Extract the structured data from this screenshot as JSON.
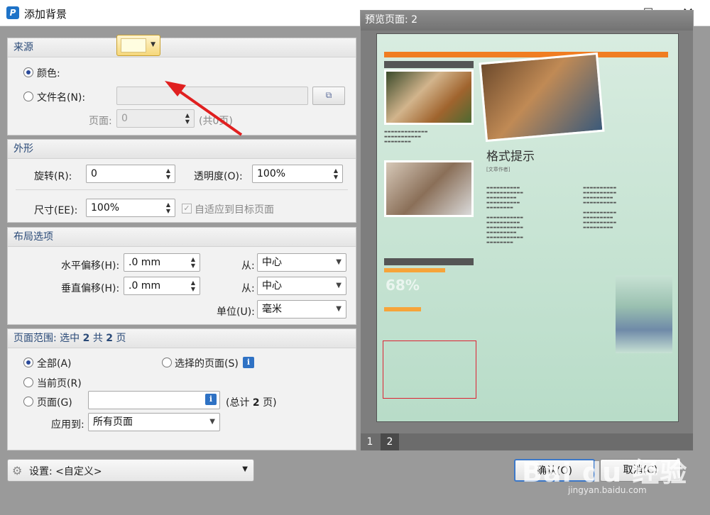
{
  "window": {
    "title": "添加背景"
  },
  "source": {
    "header": "来源",
    "color_label": "颜色:",
    "file_label": "文件名(N):",
    "page_label": "页面:",
    "page_value": "0",
    "page_total": "(共0页)",
    "color_value": "#fffde0"
  },
  "appearance": {
    "header": "外形",
    "rotate_label": "旋转(R):",
    "rotate_value": "0",
    "opacity_label": "透明度(O):",
    "opacity_value": "100%",
    "size_label": "尺寸(EE):",
    "size_value": "100%",
    "fit_label": "自适应到目标页面"
  },
  "layout": {
    "header": "布局选项",
    "h_offset_label": "水平偏移(H):",
    "h_offset_value": ".0 mm",
    "v_offset_label": "垂直偏移(H):",
    "v_offset_value": ".0 mm",
    "from_label": "从:",
    "h_from_value": "中心",
    "v_from_value": "中心",
    "unit_label": "单位(U):",
    "unit_value": "毫米"
  },
  "range": {
    "header_prefix": "页面范围: 选中",
    "header_selected": "2",
    "header_mid": "共",
    "header_total": "2",
    "header_suffix": "页",
    "all_label": "全部(A)",
    "selected_label": "选择的页面(S)",
    "current_label": "当前页(R)",
    "pages_label": "页面(G)",
    "pages_total_prefix": "(总计",
    "pages_total_num": "2",
    "pages_total_suffix": "页)",
    "apply_label": "应用到:",
    "apply_value": "所有页面"
  },
  "preview": {
    "header": "预览页面: 2",
    "pages": [
      "1",
      "2"
    ],
    "page_title": "格式提示",
    "page_author": "[文章作者]",
    "percent_text": "68%"
  },
  "footer": {
    "settings_label": "设置: <自定义>",
    "ok_label": "确认(O)",
    "cancel_label": "取消(C)"
  },
  "watermark": {
    "main": "Bai du 经验",
    "sub": "jingyan.baidu.com"
  }
}
